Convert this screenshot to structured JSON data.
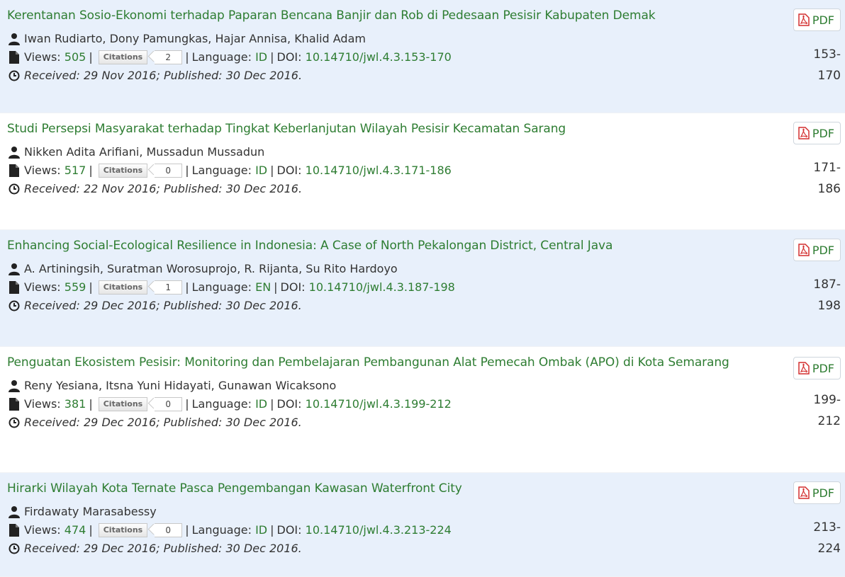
{
  "labels": {
    "views": "Views:",
    "citations_logo": "Citations",
    "language": "Language:",
    "doi": "DOI:",
    "pdf": "PDF",
    "separator": "|"
  },
  "articles": [
    {
      "title": "Kerentanan Sosio-Ekonomi terhadap Paparan Bencana Banjir dan Rob di Pedesaan Pesisir Kabupaten Demak",
      "authors": "Iwan Rudiarto, Dony Pamungkas, Hajar Annisa, Khalid Adam",
      "views": "505",
      "citations": "2",
      "language": "ID",
      "doi": "10.14710/jwl.4.3.153-170",
      "dates": "Received: 29 Nov 2016; Published: 30 Dec 2016.",
      "pages_start": "153-",
      "pages_end": "170"
    },
    {
      "title": "Studi Persepsi Masyarakat terhadap Tingkat Keberlanjutan Wilayah Pesisir Kecamatan Sarang",
      "authors": "Nikken Adita Arifiani, Mussadun Mussadun",
      "views": "517",
      "citations": "0",
      "language": "ID",
      "doi": "10.14710/jwl.4.3.171-186",
      "dates": "Received: 22 Nov 2016; Published: 30 Dec 2016.",
      "pages_start": "171-",
      "pages_end": "186"
    },
    {
      "title": "Enhancing Social-Ecological Resilience in Indonesia: A Case of North Pekalongan District, Central Java",
      "authors": "A. Artiningsih, Suratman Worosuprojo, R. Rijanta, Su Rito Hardoyo",
      "views": "559",
      "citations": "1",
      "language": "EN",
      "doi": "10.14710/jwl.4.3.187-198",
      "dates": "Received: 29 Dec 2016; Published: 30 Dec 2016.",
      "pages_start": "187-",
      "pages_end": "198"
    },
    {
      "title": "Penguatan Ekosistem Pesisir: Monitoring dan Pembelajaran Pembangunan Alat Pemecah Ombak (APO) di Kota Semarang",
      "authors": "Reny Yesiana, Itsna Yuni Hidayati, Gunawan Wicaksono",
      "views": "381",
      "citations": "0",
      "language": "ID",
      "doi": "10.14710/jwl.4.3.199-212",
      "dates": "Received: 29 Dec 2016; Published: 30 Dec 2016.",
      "pages_start": "199-",
      "pages_end": "212"
    },
    {
      "title": "Hirarki Wilayah Kota Ternate Pasca Pengembangan Kawasan Waterfront City",
      "authors": "Firdawaty Marasabessy",
      "views": "474",
      "citations": "0",
      "language": "ID",
      "doi": "10.14710/jwl.4.3.213-224",
      "dates": "Received: 29 Dec 2016; Published: 30 Dec 2016.",
      "pages_start": "213-",
      "pages_end": "224"
    }
  ],
  "icons": {
    "author": "user-icon",
    "views": "file-icon",
    "dates": "clock-icon",
    "pdf": "pdf-icon"
  },
  "colors": {
    "link_green": "#2e7d32",
    "row_highlight": "#e8f0fb",
    "pdf_red": "#d32f2f"
  }
}
